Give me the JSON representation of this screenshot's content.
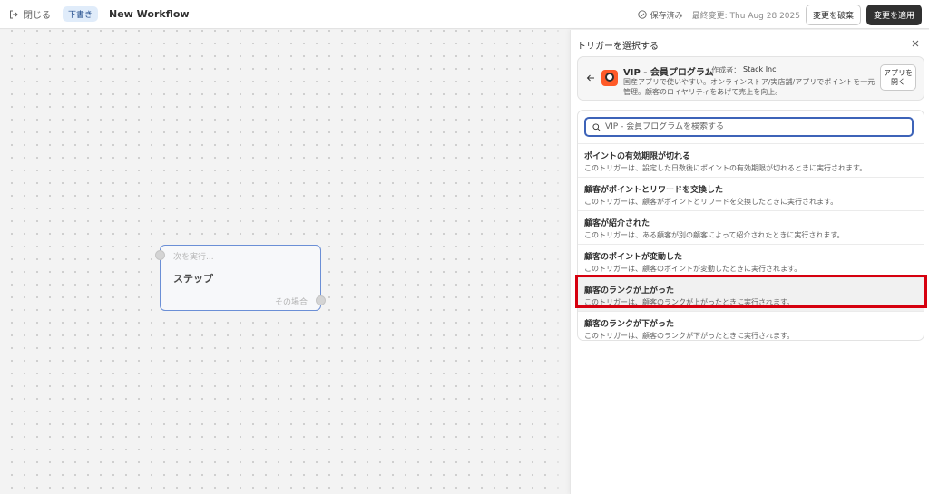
{
  "topbar": {
    "close_label": "閉じる",
    "draft_badge": "下書き",
    "workflow_title": "New Workflow",
    "saved_label": "保存済み",
    "last_modified": "最終変更: Thu Aug 28 2025",
    "discard_label": "変更を破棄",
    "apply_label": "変更を適用"
  },
  "canvas": {
    "step_node": {
      "next_label": "次を実行...",
      "title": "ステップ",
      "condition_label": "その場合"
    }
  },
  "panel": {
    "title": "トリガーを選択する",
    "app": {
      "name": "VIP - 会員プログラム",
      "by_label": "• 作成者：",
      "vendor": "Stack Inc",
      "description": "国産アプリで使いやすい。オンラインストア/実店舗/アプリでポイントを一元管理。顧客のロイヤリティをあげて売上を向上。",
      "open_button": "アプリを開く"
    },
    "search": {
      "placeholder": "VIP - 会員プログラムを検索する"
    },
    "triggers": [
      {
        "name": "ポイントの有効期限が切れる",
        "description": "このトリガーは、設定した日数後にポイントの有効期限が切れるときに実行されます。"
      },
      {
        "name": "顧客がポイントとリワードを交換した",
        "description": "このトリガーは、顧客がポイントとリワードを交換したときに実行されます。"
      },
      {
        "name": "顧客が紹介された",
        "description": "このトリガーは、ある顧客が別の顧客によって紹介されたときに実行されます。"
      },
      {
        "name": "顧客のポイントが変動した",
        "description": "このトリガーは、顧客のポイントが変動したときに実行されます。"
      },
      {
        "name": "顧客のランクが上がった",
        "description": "このトリガーは、顧客のランクが上がったときに実行されます。"
      },
      {
        "name": "顧客のランクが下がった",
        "description": "このトリガーは、顧客のランクが下がったときに実行されます。"
      }
    ],
    "highlighted_index": 4
  },
  "colors": {
    "primary_button": "#303030",
    "search_focus": "#3d63b8",
    "node_border": "#6b8fd6",
    "highlight_annotation": "#d6000f",
    "app_logo": "#ff5a28"
  }
}
